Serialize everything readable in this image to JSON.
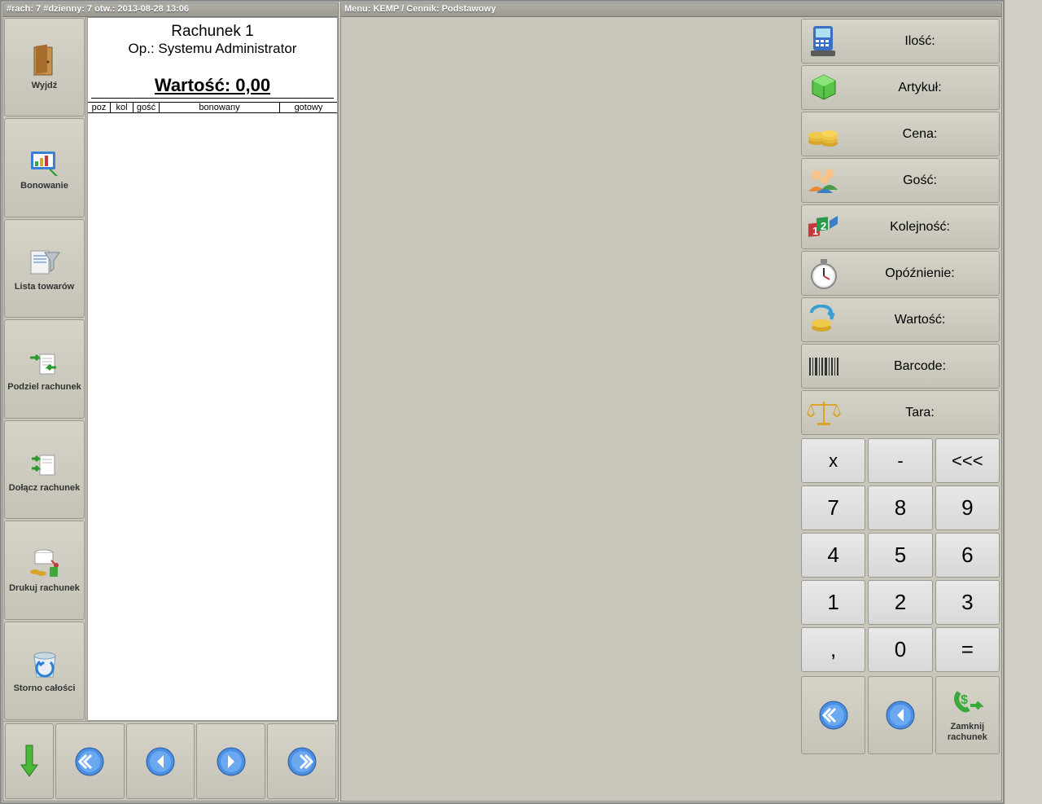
{
  "status_left": "#rach: 7 #dzienny: 7 otw.: 2013-08-28 13:06",
  "status_right": "Menu: KEMP / Cennik: Podstawowy",
  "sidebar": [
    {
      "label": "Wyjdź"
    },
    {
      "label": "Bonowanie"
    },
    {
      "label": "Lista towarów"
    },
    {
      "label": "Podziel rachunek"
    },
    {
      "label": "Dołącz rachunek"
    },
    {
      "label": "Drukuj rachunek"
    },
    {
      "label": "Storno całości"
    }
  ],
  "bill": {
    "title": "Rachunek 1",
    "operator": "Op.: Systemu Administrator",
    "value_label": "Wartość: 0,00",
    "cols": [
      "poz",
      "kol",
      "gość",
      "bonowany",
      "gotowy"
    ]
  },
  "params": [
    {
      "label": "Ilość:"
    },
    {
      "label": "Artykuł:"
    },
    {
      "label": "Cena:"
    },
    {
      "label": "Gość:"
    },
    {
      "label": "Kolejność:"
    },
    {
      "label": "Opóźnienie:"
    },
    {
      "label": "Wartość:"
    },
    {
      "label": "Barcode:"
    },
    {
      "label": "Tara:"
    }
  ],
  "numpad": [
    "x",
    "-",
    "<<<",
    "7",
    "8",
    "9",
    "4",
    "5",
    "6",
    "1",
    "2",
    "3",
    ",",
    "0",
    "="
  ],
  "right_bottom": {
    "close_label": "Zamknij rachunek"
  }
}
